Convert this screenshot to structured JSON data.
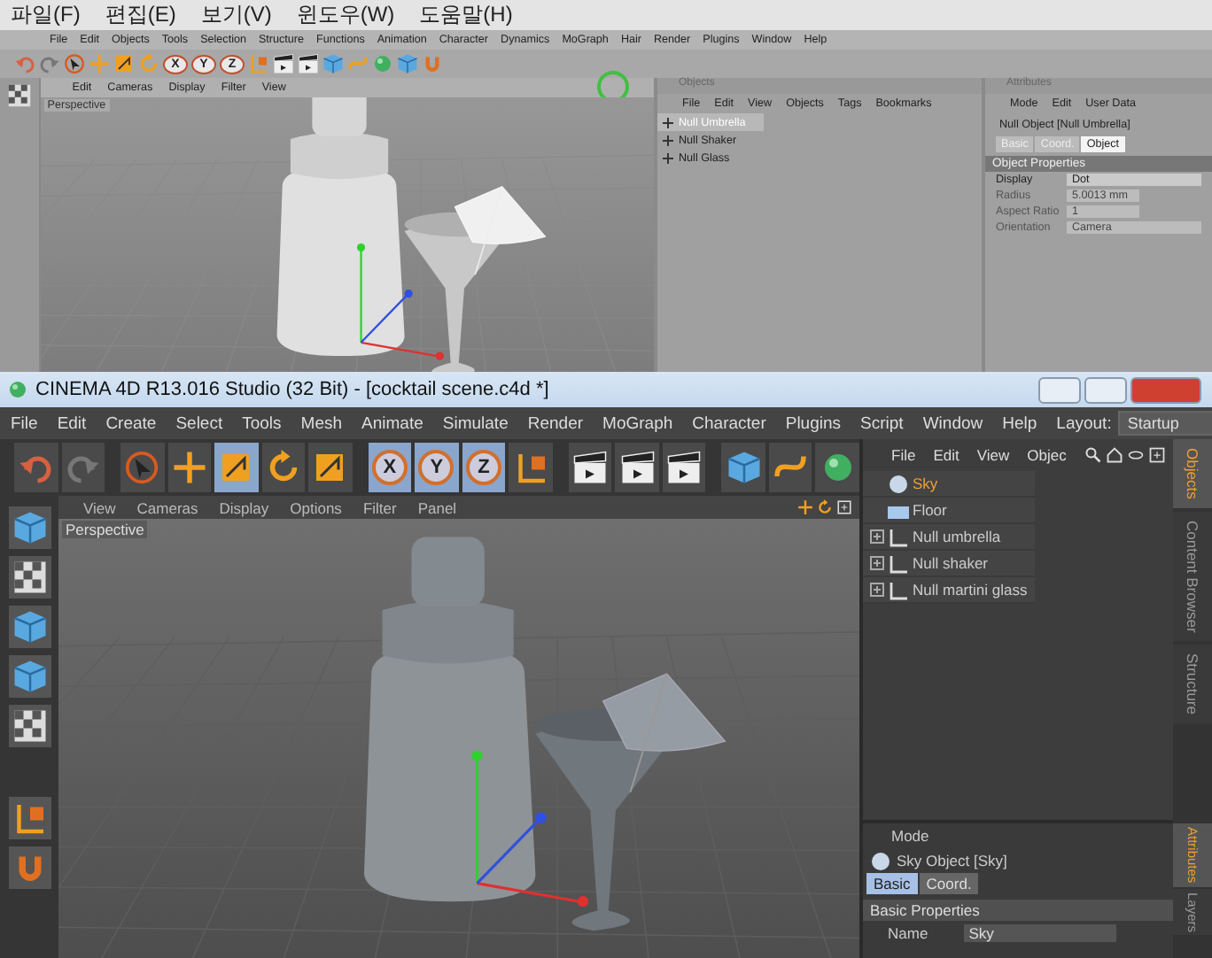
{
  "back_window": {
    "os_menu": [
      "파일(F)",
      "편집(E)",
      "보기(V)",
      "윈도우(W)",
      "도움말(H)"
    ],
    "menu": [
      "File",
      "Edit",
      "Objects",
      "Tools",
      "Selection",
      "Structure",
      "Functions",
      "Animation",
      "Character",
      "Dynamics",
      "MoGraph",
      "Hair",
      "Render",
      "Plugins",
      "Window",
      "Help"
    ],
    "axis_locks": [
      "X",
      "Y",
      "Z"
    ],
    "viewport": {
      "menu": [
        "Edit",
        "Cameras",
        "Display",
        "Filter",
        "View"
      ],
      "camera": "Perspective"
    },
    "objects": {
      "title": "Objects",
      "menu": [
        "File",
        "Edit",
        "View",
        "Objects",
        "Tags",
        "Bookmarks"
      ],
      "rows": [
        {
          "name": "Null Umbrella",
          "selected": true,
          "expanded": false
        },
        {
          "name": "Null Shaker",
          "selected": false,
          "expanded": false
        },
        {
          "name": "Null Glass",
          "selected": false,
          "expanded": false
        }
      ]
    },
    "attributes": {
      "title": "Attributes",
      "menu": [
        "Mode",
        "Edit",
        "User Data"
      ],
      "object": "Null Object [Null Umbrella]",
      "tabs": [
        {
          "label": "Basic",
          "selected": false
        },
        {
          "label": "Coord.",
          "selected": false
        },
        {
          "label": "Object",
          "selected": true
        }
      ],
      "section": "Object Properties",
      "fields": [
        {
          "label": "Display",
          "value": "Dot",
          "disabled": false,
          "kind": "dropdown"
        },
        {
          "label": "Radius",
          "value": "5.0013 mm",
          "disabled": true,
          "kind": "number"
        },
        {
          "label": "Aspect Ratio",
          "value": "1",
          "disabled": true,
          "kind": "number"
        },
        {
          "label": "Orientation",
          "value": "Camera",
          "disabled": true,
          "kind": "dropdown"
        }
      ]
    }
  },
  "window": {
    "title": "CINEMA 4D R13.016 Studio (32 Bit) - [cocktail scene.c4d *]",
    "menu": [
      "File",
      "Edit",
      "Create",
      "Select",
      "Tools",
      "Mesh",
      "Animate",
      "Simulate",
      "Render",
      "MoGraph",
      "Character",
      "Plugins",
      "Script",
      "Window",
      "Help"
    ],
    "layout_label": "Layout:",
    "layout": "Startup",
    "tools": [
      {
        "kind": "cursor",
        "selected": false
      },
      {
        "kind": "move",
        "selected": false
      },
      {
        "kind": "scale",
        "selected": true
      },
      {
        "kind": "rotate",
        "selected": false
      },
      {
        "kind": "scale",
        "selected": false
      }
    ],
    "axis_locks": [
      {
        "label": "X",
        "selected": true
      },
      {
        "label": "Y",
        "selected": true
      },
      {
        "label": "Z",
        "selected": true
      }
    ],
    "viewport": {
      "menu": [
        "View",
        "Cameras",
        "Display",
        "Options",
        "Filter",
        "Panel"
      ],
      "camera": "Perspective"
    },
    "objects": {
      "menu": [
        "File",
        "Edit",
        "View",
        "Objec"
      ],
      "rows": [
        {
          "name": "Sky",
          "kind": "sky",
          "selected": true
        },
        {
          "name": "Floor",
          "kind": "floor",
          "selected": false
        },
        {
          "name": "Null umbrella",
          "kind": "null",
          "selected": false,
          "expanded": false
        },
        {
          "name": "Null shaker",
          "kind": "null",
          "selected": false,
          "expanded": false
        },
        {
          "name": "Null martini glass",
          "kind": "null",
          "selected": false,
          "expanded": false
        }
      ]
    },
    "side_tabs": [
      {
        "label": "Objects",
        "selected": true
      },
      {
        "label": "Content Browser",
        "selected": false
      },
      {
        "label": "Structure",
        "selected": false
      }
    ],
    "attributes": {
      "menu": [
        "Mode"
      ],
      "object": "Sky Object [Sky]",
      "tabs": [
        {
          "label": "Basic",
          "selected": true
        },
        {
          "label": "Coord.",
          "selected": false
        }
      ],
      "section": "Basic Properties",
      "fields": [
        {
          "label": "Name",
          "value": "Sky"
        }
      ]
    },
    "attr_side_tabs": [
      {
        "label": "Attributes",
        "selected": true
      },
      {
        "label": "Layers",
        "selected": false
      }
    ]
  }
}
